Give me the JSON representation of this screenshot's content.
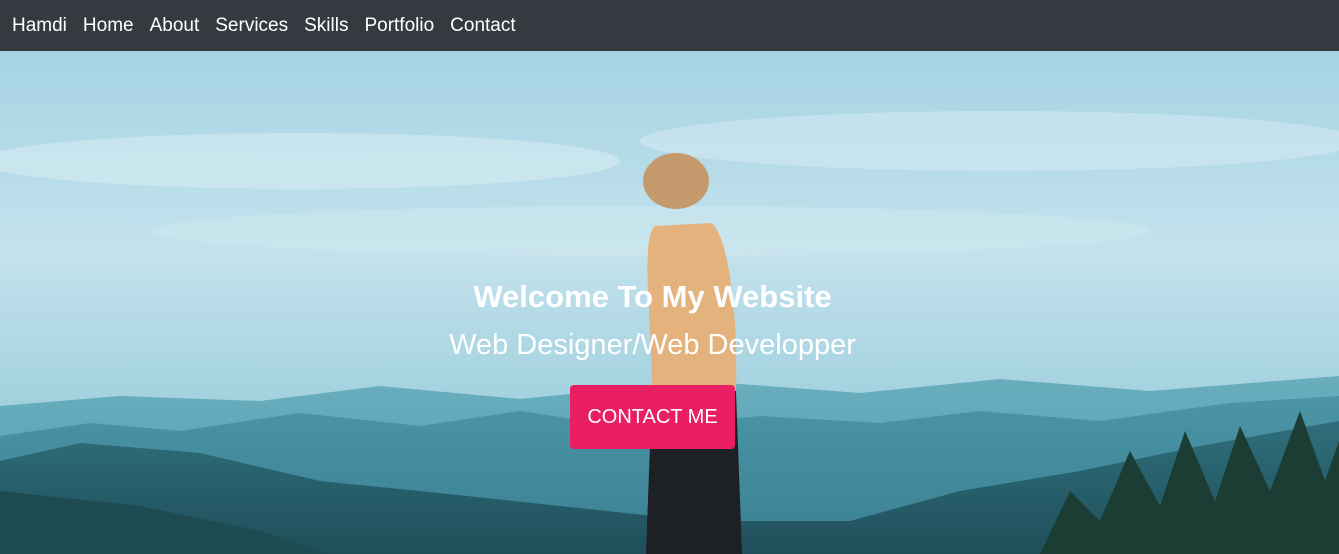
{
  "nav": {
    "brand": "Hamdi",
    "items": [
      {
        "label": "Home"
      },
      {
        "label": "About"
      },
      {
        "label": "Services"
      },
      {
        "label": "Skills"
      },
      {
        "label": "Portfolio"
      },
      {
        "label": "Contact"
      }
    ]
  },
  "hero": {
    "title": "Welcome To My Website",
    "subtitle": "Web Designer/Web Developper",
    "cta_label": "CONTACT ME",
    "background_image": "person-on-mountain-photo"
  },
  "colors": {
    "navbar": "#343a40",
    "accent": "#e91e63",
    "text": "#ffffff"
  }
}
